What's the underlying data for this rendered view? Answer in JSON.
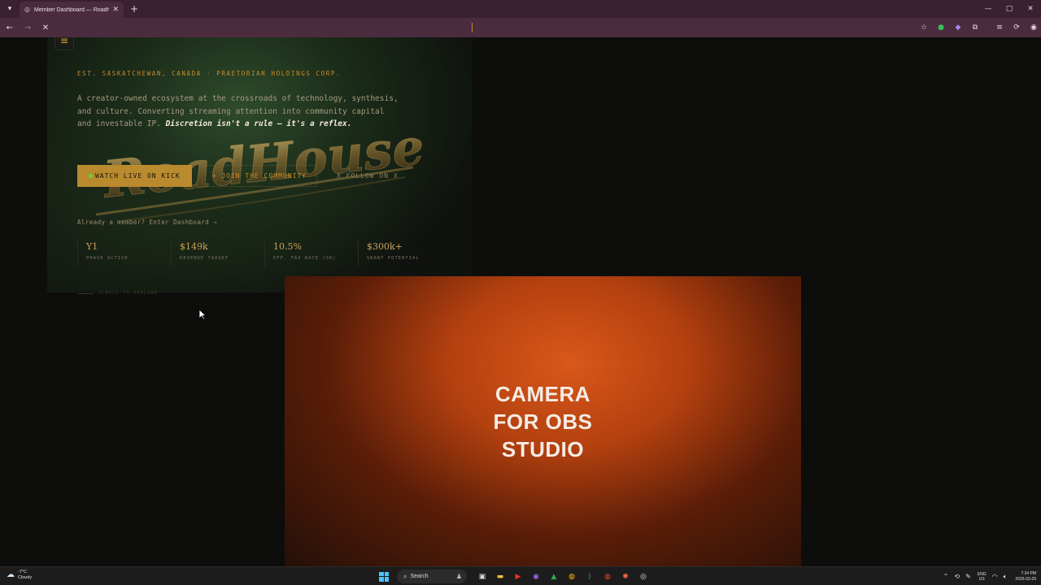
{
  "browser": {
    "tab_title": "Member Dashboard — Roadh",
    "new_tab": "+",
    "tab_close": "✕",
    "window": {
      "minimize": "—",
      "maximize": "▢",
      "close": "✕"
    }
  },
  "hero": {
    "eyebrow": "EST. SASKATCHEWAN, CANADA · PRAETORIAN HOLDINGS CORP.",
    "intro_text": "A creator-owned ecosystem at the crossroads of technology, synthesis, and culture. Converting streaming attention into community capital and investable IP. ",
    "intro_emphasis": "Discretion isn't a rule — it's a reflex.",
    "logo_text": "RoadHouse",
    "cta": {
      "primary": "WATCH LIVE ON KICK",
      "community": "+ JOIN THE COMMUNITY",
      "x": "X FOLLOW ON X"
    },
    "member_link": "Already a member? Enter Dashboard →",
    "stats": [
      {
        "value": "Y1",
        "label": "PHASE ACTIVE"
      },
      {
        "value": "$149k",
        "label": "REVENUE TARGET"
      },
      {
        "value": "10.5%",
        "label": "EFF. TAX RATE (SK)"
      },
      {
        "value": "$300k+",
        "label": "GRANT POTENTIAL"
      }
    ],
    "scroll_hint": "SCROLL TO EXPLORE"
  },
  "video": {
    "caption": "CAMERA\nFOR OBS\nSTUDIO"
  },
  "taskbar": {
    "weather_temp": "-7°C",
    "weather_desc": "Cloudy",
    "search_label": "Search",
    "lang_top": "ENG",
    "lang_bottom": "US",
    "time": "7:34 PM",
    "date": "2026-03-29"
  },
  "colors": {
    "accent_gold": "#b98a2e",
    "eyebrow_orange": "#c98a2a",
    "live_dot": "#63d34a",
    "chrome_bg": "#4b2c3e"
  }
}
